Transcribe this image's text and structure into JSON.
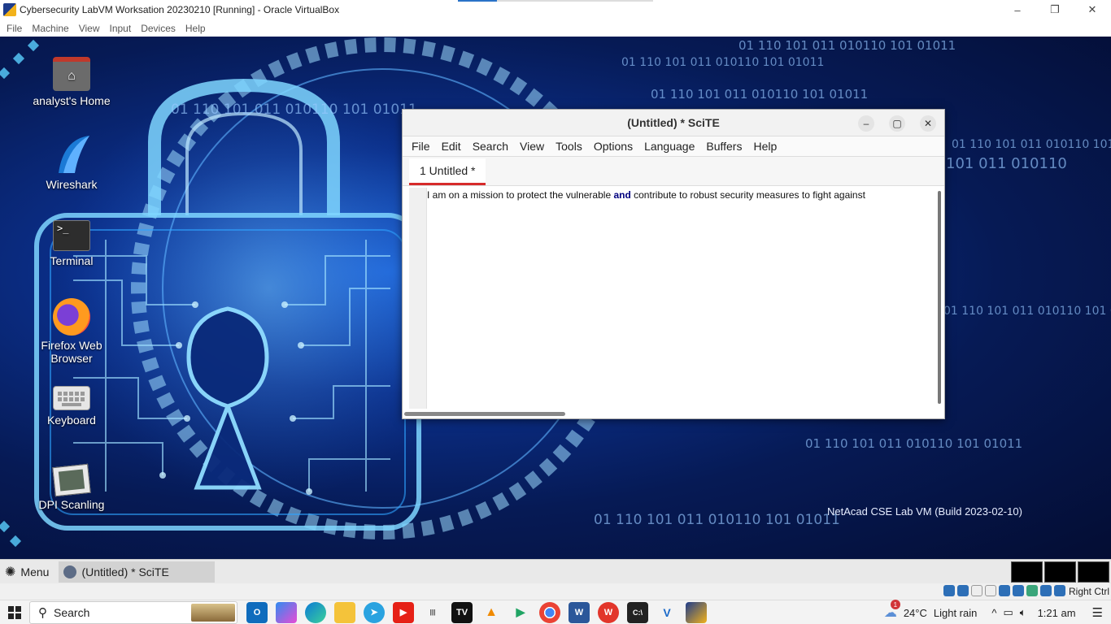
{
  "host": {
    "window_title": "Cybersecurity LabVM Worksation 20230210 [Running] - Oracle VirtualBox",
    "menu": [
      "File",
      "Machine",
      "View",
      "Input",
      "Devices",
      "Help"
    ],
    "window_controls": {
      "minimize": "–",
      "maximize": "❐",
      "close": "✕"
    },
    "status_hostkey": "Right Ctrl"
  },
  "desktop": {
    "icons": [
      {
        "label": "analyst's Home",
        "icon": "home-folder-icon"
      },
      {
        "label": "Wireshark",
        "icon": "wireshark-icon"
      },
      {
        "label": "Terminal",
        "icon": "terminal-icon"
      },
      {
        "label": "Firefox Web Browser",
        "icon": "firefox-icon"
      },
      {
        "label": "Keyboard",
        "icon": "keyboard-icon"
      },
      {
        "label": "DPI Scanling",
        "icon": "dpi-scanling-icon"
      }
    ],
    "build_text": "NetAcad CSE Lab VM (Build 2023-02-10)",
    "binary_strings": [
      "01 110 101 011 010110 101 01011",
      "01 110 101 011 010110 101 01011",
      "01 110 101 011 010110 101 01011",
      "01 110 101 011 010110 101 01011",
      "01 110 101 011 010110 101 01011",
      "01 110 101 011 010110 101 01011",
      "101 011 010110",
      "01 110 101 011 010110 101 01011",
      "01 110 101 011 010110 101 01011"
    ]
  },
  "scite": {
    "title": "(Untitled) * SciTE",
    "menu": [
      "File",
      "Edit",
      "Search",
      "View",
      "Tools",
      "Options",
      "Language",
      "Buffers",
      "Help"
    ],
    "tab": "1 Untitled *",
    "text_before": "I am on a mission to protect the vulnerable ",
    "keyword": "and",
    "text_after": " contribute to robust security measures to fight against",
    "controls": {
      "minimize": "–",
      "maximize": "▢",
      "close": "✕"
    }
  },
  "guest_taskbar": {
    "menu_label": "Menu",
    "task_label": "(Untitled) * SciTE"
  },
  "windows_taskbar": {
    "search_label": "Search",
    "apps": [
      "outlook-icon",
      "copilot-icon",
      "edge-icon",
      "file-explorer-icon",
      "telegram-icon",
      "youtube-icon",
      "cisco-icon",
      "tradingview-icon",
      "vlc-icon",
      "play-store-icon",
      "chrome-icon",
      "word-icon",
      "wps-icon",
      "terminal-icon",
      "vs-icon",
      "virtualbox-icon"
    ],
    "weather_temp": "24°C",
    "weather_desc": "Light rain",
    "time": "1:21 am",
    "notification_count": "1"
  }
}
